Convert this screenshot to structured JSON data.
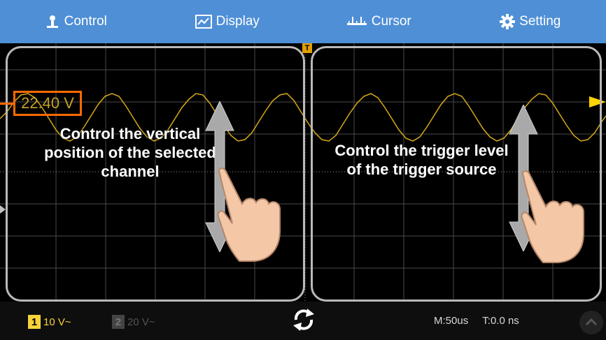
{
  "top_tabs": [
    {
      "label": "Control",
      "icon": "person-icon"
    },
    {
      "label": "Display",
      "icon": "chart-icon"
    },
    {
      "label": "Cursor",
      "icon": "ruler-icon"
    },
    {
      "label": "Setting",
      "icon": "gear-icon"
    }
  ],
  "overlay": {
    "left_caption": "Control the vertical position of the selected channel",
    "right_caption": "Control the trigger level of the trigger source",
    "channel_offset_label": "22.40 V"
  },
  "trigger_marker": "T",
  "bottom": {
    "ch1": {
      "number": "1",
      "scale": "10 V~"
    },
    "ch2": {
      "number": "2",
      "scale": "20 V~"
    },
    "timebase": "M:50us",
    "trigger_time": "T:0.0 ns"
  },
  "colors": {
    "topbar": "#4f8fd6",
    "ch1": "#f7d33b",
    "highlight": "#ff6a00",
    "trigger_level": "#ffd400"
  }
}
